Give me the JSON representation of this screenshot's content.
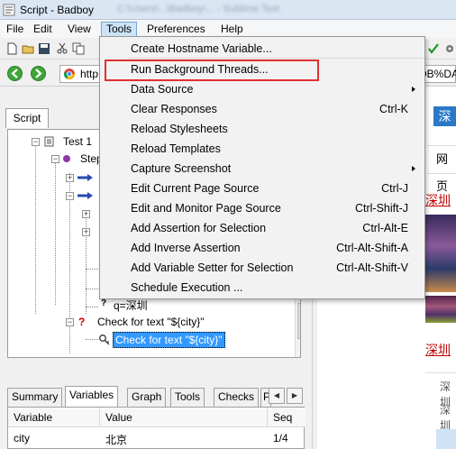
{
  "window": {
    "title": "Script - Badboy",
    "blurred_path": "C:\\Users\\...\\Badboy\\... - Sublime Text"
  },
  "menubar": [
    "File",
    "Edit",
    "View",
    "Tools",
    "Preferences",
    "Help"
  ],
  "address": {
    "url_prefix": "http",
    "url_suffix": "DB%DA"
  },
  "script_tab": "Script",
  "tree": {
    "test": "Test 1",
    "step": "Step",
    "item_q": "q=深圳",
    "check1": "Check for text \"${city}\"",
    "check2_selected": "Check for text \"${city}\""
  },
  "bottom_tabs": [
    "Summary",
    "Variables",
    "Graph",
    "Tools",
    "Checks",
    "P"
  ],
  "variables": {
    "headers": [
      "Variable",
      "Value",
      "Seq"
    ],
    "rows": [
      {
        "variable": "city",
        "value": "北京",
        "seq": "1/4"
      }
    ]
  },
  "browser": {
    "search_btn": "深圳",
    "bar_text": "网页",
    "link1": "深圳",
    "link2": "深圳",
    "gray1": "深圳",
    "gray2": "深圳"
  },
  "tools_menu": [
    {
      "label": "Create Hostname Variable...",
      "shortcut": ""
    },
    {
      "label": "Run Background Threads...",
      "shortcut": "",
      "highlighted_red": true
    },
    {
      "label": "Data Source",
      "shortcut": "",
      "submenu": true
    },
    {
      "label": "Clear Responses",
      "shortcut": "Ctrl-K"
    },
    {
      "label": "Reload Stylesheets",
      "shortcut": ""
    },
    {
      "label": "Reload Templates",
      "shortcut": ""
    },
    {
      "label": "Capture Screenshot",
      "shortcut": "",
      "submenu": true
    },
    {
      "label": "Edit Current Page Source",
      "shortcut": "Ctrl-J"
    },
    {
      "label": "Edit and Monitor Page Source",
      "shortcut": "Ctrl-Shift-J"
    },
    {
      "label": "Add Assertion for Selection",
      "shortcut": "Ctrl-Alt-E"
    },
    {
      "label": "Add Inverse Assertion",
      "shortcut": "Ctrl-Alt-Shift-A"
    },
    {
      "label": "Add Variable Setter for Selection",
      "shortcut": "Ctrl-Alt-Shift-V"
    },
    {
      "label": "Schedule Execution ...",
      "shortcut": ""
    }
  ],
  "colors": {
    "menu_highlight": "#cce4f7",
    "red_box": "#e03030",
    "selection": "#3399ff",
    "link_red": "#c00000",
    "nav_green": "#3fa53b"
  }
}
